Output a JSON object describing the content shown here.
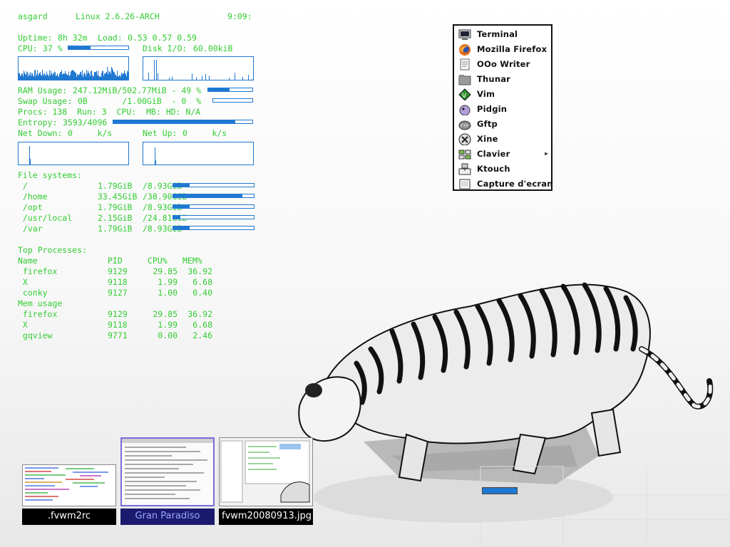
{
  "conky": {
    "host": "asgard",
    "kernel": "Linux 2.6.26-ARCH",
    "time": "9:09:",
    "uptime_label": "Uptime:",
    "uptime_value": "8h 32m",
    "load_label": "Load:",
    "load_value": "0.53 0.57 0.59",
    "cpu_label": "CPU:",
    "cpu_value": "37 %",
    "cpu_fraction": 0.37,
    "disk_label": "Disk I/O:",
    "disk_value": "60.00kiB",
    "ram_label": "RAM Usage:",
    "ram_value": "247.12MiB/502.77MiB - 49 %",
    "ram_fraction": 0.49,
    "swap_label": "Swap Usage:",
    "swap_value": "0B       /1.00GiB  - 0  %",
    "swap_fraction": 0.0,
    "procs_line": "Procs: 138  Run: 3  CPU:  MB: HD: N/A",
    "entropy_label": "Entropy:",
    "entropy_value": "3593/4096",
    "entropy_fraction": 0.877,
    "net_down_label": "Net Down:",
    "net_down_value": "0     k/s",
    "net_up_label": "Net Up:",
    "net_up_value": "0     k/s",
    "fs_title": "File systems:",
    "filesystems": [
      {
        "mount": " /",
        "used": "1.79GiB",
        "size": "/8.93GiB",
        "fraction": 0.2
      },
      {
        "mount": " /home",
        "used": "33.45GiB",
        "size": "/38.90GiB",
        "fraction": 0.86
      },
      {
        "mount": " /opt",
        "used": "1.79GiB",
        "size": "/8.93GiB",
        "fraction": 0.2
      },
      {
        "mount": " /usr/local",
        "used": "2.15GiB",
        "size": "/24.81GiB",
        "fraction": 0.09
      },
      {
        "mount": " /var",
        "used": "1.79GiB",
        "size": "/8.93GiB",
        "fraction": 0.2
      }
    ],
    "top_title": "Top Processes:",
    "col_name": "Name",
    "col_pid": "PID",
    "col_cpu": "CPU%",
    "col_mem": "MEM%",
    "top_cpu": [
      {
        "name": " firefox",
        "pid": "9129",
        "cpu": "29.85",
        "mem": "36.92"
      },
      {
        "name": " X",
        "pid": "9118",
        "cpu": "1.99",
        "mem": "6.68"
      },
      {
        "name": " conky",
        "pid": "9127",
        "cpu": "1.00",
        "mem": "0.40"
      }
    ],
    "mem_title": "Mem usage",
    "top_mem": [
      {
        "name": " firefox",
        "pid": "9129",
        "cpu": "29.85",
        "mem": "36.92"
      },
      {
        "name": " X",
        "pid": "9118",
        "cpu": "1.99",
        "mem": "6.68"
      },
      {
        "name": " gqview",
        "pid": "9771",
        "cpu": "0.00",
        "mem": "2.46"
      }
    ]
  },
  "menu": {
    "items": [
      {
        "label": "Terminal",
        "icon": "terminal-icon"
      },
      {
        "label": "Mozilla Firefox",
        "icon": "firefox-icon"
      },
      {
        "label": "OOo Writer",
        "icon": "writer-icon"
      },
      {
        "label": "Thunar",
        "icon": "folder-icon"
      },
      {
        "label": "Vim",
        "icon": "vim-icon"
      },
      {
        "label": "Pidgin",
        "icon": "pidgin-icon"
      },
      {
        "label": "Gftp",
        "icon": "ftp-icon"
      },
      {
        "label": "Xine",
        "icon": "xine-icon"
      },
      {
        "label": "Clavier",
        "icon": "keyboard-icon",
        "submenu": true
      },
      {
        "label": "Ktouch",
        "icon": "ktouch-icon"
      },
      {
        "label": "Capture d'ecran",
        "icon": "screenshot-icon"
      }
    ]
  },
  "pager": {
    "windows": [
      {
        "label": ".fvwm2rc"
      },
      {
        "label": "Gran Paradiso"
      },
      {
        "label": "fvwm20080913.jpg - "
      }
    ]
  },
  "colors": {
    "conky_text": "#33cc33",
    "conky_bar": "#1f78d1",
    "menu_border": "#111111",
    "pager_label_bg": "#000000",
    "pager_active_text": "#9aa8ff"
  }
}
